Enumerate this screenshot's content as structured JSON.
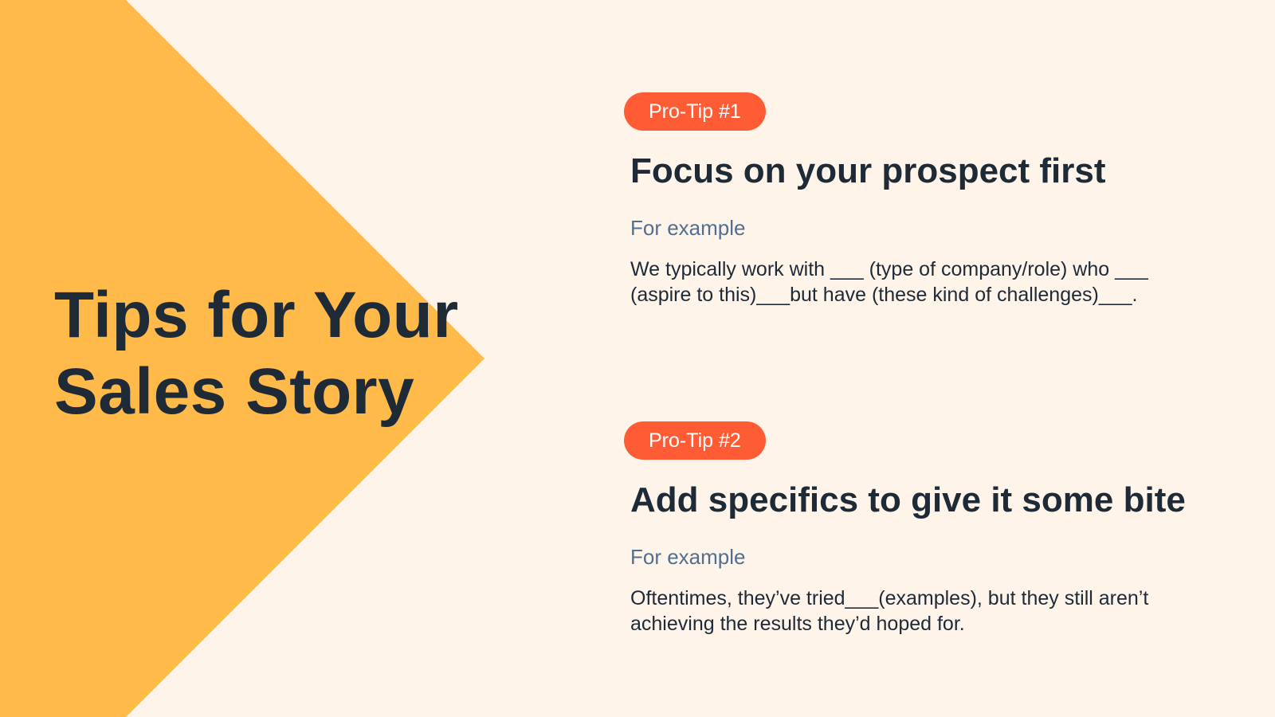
{
  "colors": {
    "background": "#FEF4EA",
    "chevron": "#FFBA4A",
    "badge": "#FF5C35",
    "heading": "#1E2A36",
    "label": "#516F90"
  },
  "title": {
    "line1": "Tips for Your",
    "line2": "Sales Story"
  },
  "tips": [
    {
      "badge": "Pro-Tip #1",
      "heading": "Focus on your prospect first",
      "label": "For example",
      "body": "We typically work with ___ (type of company/role) who ___ (aspire to this)___but have (these kind of challenges)___."
    },
    {
      "badge": "Pro-Tip #2",
      "heading": "Add specifics to give it some bite",
      "label": "For example",
      "body": "Oftentimes, they’ve tried___(examples), but they still aren’t achieving the results they’d hoped for."
    }
  ]
}
